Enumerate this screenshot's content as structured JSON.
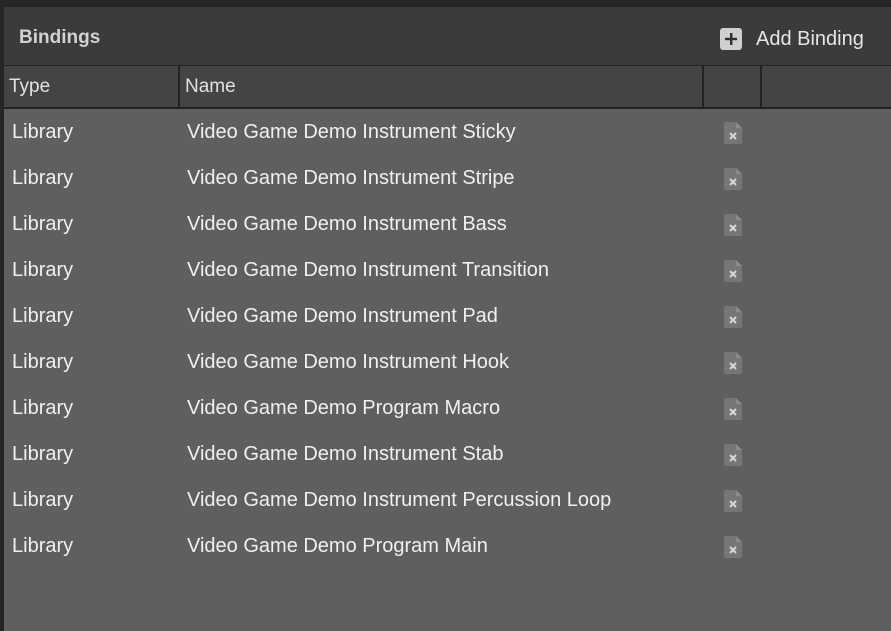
{
  "panel": {
    "title": "Bindings",
    "add_button_label": "Add Binding"
  },
  "table": {
    "columns": [
      "Type",
      "Name",
      "",
      ""
    ],
    "rows": [
      {
        "type": "Library",
        "name": "Video Game Demo Instrument Sticky"
      },
      {
        "type": "Library",
        "name": "Video Game Demo Instrument Stripe"
      },
      {
        "type": "Library",
        "name": "Video Game Demo Instrument Bass"
      },
      {
        "type": "Library",
        "name": "Video Game Demo Instrument Transition"
      },
      {
        "type": "Library",
        "name": "Video Game Demo Instrument Pad"
      },
      {
        "type": "Library",
        "name": "Video Game Demo Instrument Hook"
      },
      {
        "type": "Library",
        "name": "Video Game Demo Program Macro"
      },
      {
        "type": "Library",
        "name": "Video Game Demo Instrument Stab"
      },
      {
        "type": "Library",
        "name": "Video Game Demo Instrument Percussion Loop"
      },
      {
        "type": "Library",
        "name": "Video Game Demo Program Main"
      }
    ]
  },
  "icons": {
    "add": "plus-icon",
    "row_action": "remove-document-icon"
  },
  "colors": {
    "panel_background": "#3b3b3b",
    "table_background": "#5f5f5f",
    "header_background": "#444444",
    "text": "#f0f0f0"
  }
}
